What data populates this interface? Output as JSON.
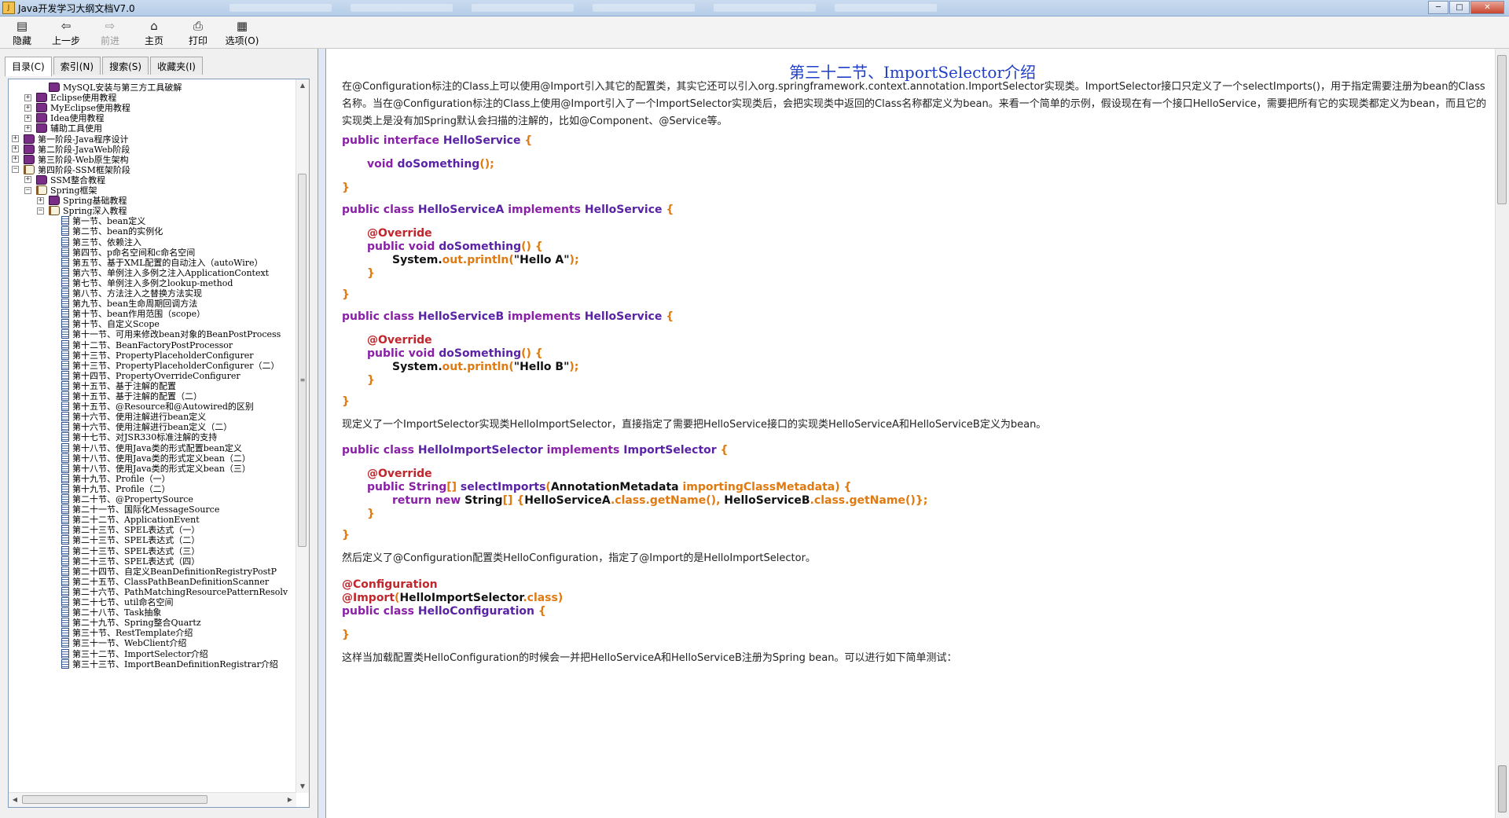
{
  "window": {
    "title": "Java开发学习大纲文档V7.0",
    "buttons": {
      "minimize": "─",
      "maximize": "□",
      "close": "✕"
    }
  },
  "toolbar": {
    "buttons": [
      {
        "label": "隐藏",
        "icon": "hide-pane-icon",
        "glyph": "▤",
        "enabled": true
      },
      {
        "label": "上一步",
        "icon": "back-arrow-icon",
        "glyph": "⇦",
        "enabled": true
      },
      {
        "label": "前进",
        "icon": "forward-arrow-icon",
        "glyph": "⇨",
        "enabled": false
      },
      {
        "label": "主页",
        "icon": "home-icon",
        "glyph": "⌂",
        "enabled": true
      },
      {
        "label": "打印",
        "icon": "printer-icon",
        "glyph": "⎙",
        "enabled": true
      },
      {
        "label": "选项(O)",
        "icon": "options-icon",
        "glyph": "▦",
        "enabled": true
      }
    ]
  },
  "sidebar": {
    "tabs": [
      "目录(C)",
      "索引(N)",
      "搜索(S)",
      "收藏夹(I)"
    ],
    "active_tab": 0,
    "tree": [
      {
        "depth": 2,
        "type": "book",
        "expander": "",
        "label": "MySQL安装与第三方工具破解"
      },
      {
        "depth": 1,
        "type": "book",
        "expander": "+",
        "label": "Eclipse使用教程"
      },
      {
        "depth": 1,
        "type": "book",
        "expander": "+",
        "label": "MyEclipse使用教程"
      },
      {
        "depth": 1,
        "type": "book",
        "expander": "+",
        "label": "Idea使用教程"
      },
      {
        "depth": 1,
        "type": "book",
        "expander": "+",
        "label": "辅助工具使用"
      },
      {
        "depth": 0,
        "type": "book",
        "expander": "+",
        "label": "第一阶段-Java程序设计"
      },
      {
        "depth": 0,
        "type": "book",
        "expander": "+",
        "label": "第二阶段-JavaWeb阶段"
      },
      {
        "depth": 0,
        "type": "book",
        "expander": "+",
        "label": "第三阶段-Web原生架构"
      },
      {
        "depth": 0,
        "type": "open",
        "expander": "−",
        "label": "第四阶段-SSM框架阶段"
      },
      {
        "depth": 1,
        "type": "book",
        "expander": "+",
        "label": "SSM整合教程"
      },
      {
        "depth": 1,
        "type": "open",
        "expander": "−",
        "label": "Spring框架"
      },
      {
        "depth": 2,
        "type": "book",
        "expander": "+",
        "label": "Spring基础教程"
      },
      {
        "depth": 2,
        "type": "open",
        "expander": "−",
        "label": "Spring深入教程"
      },
      {
        "depth": 3,
        "type": "page",
        "expander": "",
        "label": "第一节、bean定义"
      },
      {
        "depth": 3,
        "type": "page",
        "expander": "",
        "label": "第二节、bean的实例化"
      },
      {
        "depth": 3,
        "type": "page",
        "expander": "",
        "label": "第三节、依赖注入"
      },
      {
        "depth": 3,
        "type": "page",
        "expander": "",
        "label": "第四节、p命名空间和c命名空间"
      },
      {
        "depth": 3,
        "type": "page",
        "expander": "",
        "label": "第五节、基于XML配置的自动注入（autoWire）"
      },
      {
        "depth": 3,
        "type": "page",
        "expander": "",
        "label": "第六节、单例注入多例之注入ApplicationContext"
      },
      {
        "depth": 3,
        "type": "page",
        "expander": "",
        "label": "第七节、单例注入多例之lookup-method"
      },
      {
        "depth": 3,
        "type": "page",
        "expander": "",
        "label": "第八节、方法注入之替换方法实现"
      },
      {
        "depth": 3,
        "type": "page",
        "expander": "",
        "label": "第九节、bean生命周期回调方法"
      },
      {
        "depth": 3,
        "type": "page",
        "expander": "",
        "label": "第十节、bean作用范围（scope）"
      },
      {
        "depth": 3,
        "type": "page",
        "expander": "",
        "label": "第十节、自定义Scope"
      },
      {
        "depth": 3,
        "type": "page",
        "expander": "",
        "label": "第十一节、可用来修改bean对象的BeanPostProcess"
      },
      {
        "depth": 3,
        "type": "page",
        "expander": "",
        "label": "第十二节、BeanFactoryPostProcessor"
      },
      {
        "depth": 3,
        "type": "page",
        "expander": "",
        "label": "第十三节、PropertyPlaceholderConfigurer"
      },
      {
        "depth": 3,
        "type": "page",
        "expander": "",
        "label": "第十三节、PropertyPlaceholderConfigurer（二）"
      },
      {
        "depth": 3,
        "type": "page",
        "expander": "",
        "label": "第十四节、PropertyOverrideConfigurer"
      },
      {
        "depth": 3,
        "type": "page",
        "expander": "",
        "label": "第十五节、基于注解的配置"
      },
      {
        "depth": 3,
        "type": "page",
        "expander": "",
        "label": "第十五节、基于注解的配置（二）"
      },
      {
        "depth": 3,
        "type": "page",
        "expander": "",
        "label": "第十五节、@Resource和@Autowired的区别"
      },
      {
        "depth": 3,
        "type": "page",
        "expander": "",
        "label": "第十六节、使用注解进行bean定义"
      },
      {
        "depth": 3,
        "type": "page",
        "expander": "",
        "label": "第十六节、使用注解进行bean定义（二）"
      },
      {
        "depth": 3,
        "type": "page",
        "expander": "",
        "label": "第十七节、对JSR330标准注解的支持"
      },
      {
        "depth": 3,
        "type": "page",
        "expander": "",
        "label": "第十八节、使用Java类的形式配置bean定义"
      },
      {
        "depth": 3,
        "type": "page",
        "expander": "",
        "label": "第十八节、使用Java类的形式定义bean（二）"
      },
      {
        "depth": 3,
        "type": "page",
        "expander": "",
        "label": "第十八节、使用Java类的形式定义bean（三）"
      },
      {
        "depth": 3,
        "type": "page",
        "expander": "",
        "label": "第十九节、Profile（一）"
      },
      {
        "depth": 3,
        "type": "page",
        "expander": "",
        "label": "第十九节、Profile（二）"
      },
      {
        "depth": 3,
        "type": "page",
        "expander": "",
        "label": "第二十节、@PropertySource"
      },
      {
        "depth": 3,
        "type": "page",
        "expander": "",
        "label": "第二十一节、国际化MessageSource"
      },
      {
        "depth": 3,
        "type": "page",
        "expander": "",
        "label": "第二十二节、ApplicationEvent"
      },
      {
        "depth": 3,
        "type": "page",
        "expander": "",
        "label": "第二十三节、SPEL表达式（一）"
      },
      {
        "depth": 3,
        "type": "page",
        "expander": "",
        "label": "第二十三节、SPEL表达式（二）"
      },
      {
        "depth": 3,
        "type": "page",
        "expander": "",
        "label": "第二十三节、SPEL表达式（三）"
      },
      {
        "depth": 3,
        "type": "page",
        "expander": "",
        "label": "第二十三节、SPEL表达式（四）"
      },
      {
        "depth": 3,
        "type": "page",
        "expander": "",
        "label": "第二十四节、自定义BeanDefinitionRegistryPostP"
      },
      {
        "depth": 3,
        "type": "page",
        "expander": "",
        "label": "第二十五节、ClassPathBeanDefinitionScanner"
      },
      {
        "depth": 3,
        "type": "page",
        "expander": "",
        "label": "第二十六节、PathMatchingResourcePatternResolv"
      },
      {
        "depth": 3,
        "type": "page",
        "expander": "",
        "label": "第二十七节、util命名空间"
      },
      {
        "depth": 3,
        "type": "page",
        "expander": "",
        "label": "第二十八节、Task抽象"
      },
      {
        "depth": 3,
        "type": "page",
        "expander": "",
        "label": "第二十九节、Spring整合Quartz"
      },
      {
        "depth": 3,
        "type": "page",
        "expander": "",
        "label": "第三十节、RestTemplate介绍"
      },
      {
        "depth": 3,
        "type": "page",
        "expander": "",
        "label": "第三十一节、WebClient介绍"
      },
      {
        "depth": 3,
        "type": "page",
        "expander": "",
        "label": "第三十二节、ImportSelector介绍"
      },
      {
        "depth": 3,
        "type": "page",
        "expander": "",
        "label": "第三十三节、ImportBeanDefinitionRegistrar介绍"
      }
    ]
  },
  "content": {
    "title": "第三十二节、ImportSelector介绍",
    "intro": "在@Configuration标注的Class上可以使用@Import引入其它的配置类，其实它还可以引入org.springframework.context.annotation.ImportSelector实现类。ImportSelector接口只定义了一个selectImports()，用于指定需要注册为bean的Class名称。当在@Configuration标注的Class上使用@Import引入了一个ImportSelector实现类后，会把实现类中返回的Class名称都定义为bean。来看一个简单的示例，假设现在有一个接口HelloService，需要把所有它的实现类都定义为bean，而且它的实现类上是没有加Spring默认会扫描的注解的，比如@Component、@Service等。",
    "para2": "现定义了一个ImportSelector实现类HelloImportSelector，直接指定了需要把HelloService接口的实现类HelloServiceA和HelloServiceB定义为bean。",
    "para3": "然后定义了@Configuration配置类HelloConfiguration，指定了@Import的是HelloImportSelector。",
    "para4": "这样当加载配置类HelloConfiguration的时候会一并把HelloServiceA和HelloServiceB注册为Spring bean。可以进行如下简单测试：",
    "code": {
      "iface_l1": [
        "public interface ",
        "HelloService",
        " {"
      ],
      "iface_l2": [
        "void ",
        "doSomething",
        "();"
      ],
      "close": "}",
      "a_l1": [
        "public class ",
        "HelloServiceA",
        " implements ",
        "HelloService",
        " {"
      ],
      "override": "@Override",
      "m_l1": [
        "public void ",
        "doSomething",
        "() {"
      ],
      "a_print": [
        "System.",
        "out",
        ".",
        "println",
        "(",
        "\"Hello A\"",
        ");"
      ],
      "inner_close": "}",
      "b_l1": [
        "public class ",
        "HelloServiceB",
        " implements ",
        "HelloService",
        " {"
      ],
      "b_print": [
        "System.",
        "out",
        ".",
        "println",
        "(",
        "\"Hello B\"",
        ");"
      ],
      "s_l1": [
        "public class ",
        "HelloImportSelector",
        " implements ",
        "ImportSelector",
        " {"
      ],
      "s_l2": [
        "public ",
        "String",
        "[] ",
        "selectImports",
        "(",
        "AnnotationMetadata",
        " ",
        "importingClassMetadata",
        ") {"
      ],
      "s_l3": [
        "return ",
        "new ",
        "String",
        "[] {",
        "HelloServiceA",
        ".",
        "class",
        ".",
        "getName",
        "(), ",
        "HelloServiceB",
        ".",
        "class",
        ".",
        "getName",
        "()};"
      ],
      "c_l1": "@Configuration",
      "c_l2": [
        "@Import",
        "(",
        "HelloImportSelector",
        ".",
        "class",
        ")"
      ],
      "c_l3": [
        "public class ",
        "HelloConfiguration",
        " {"
      ]
    }
  },
  "colors": {
    "title_blue": "#1f3ec9",
    "keyword_purple": "#8a1fa8",
    "annotation_red": "#c0262b",
    "punct_orange": "#e07a10"
  }
}
